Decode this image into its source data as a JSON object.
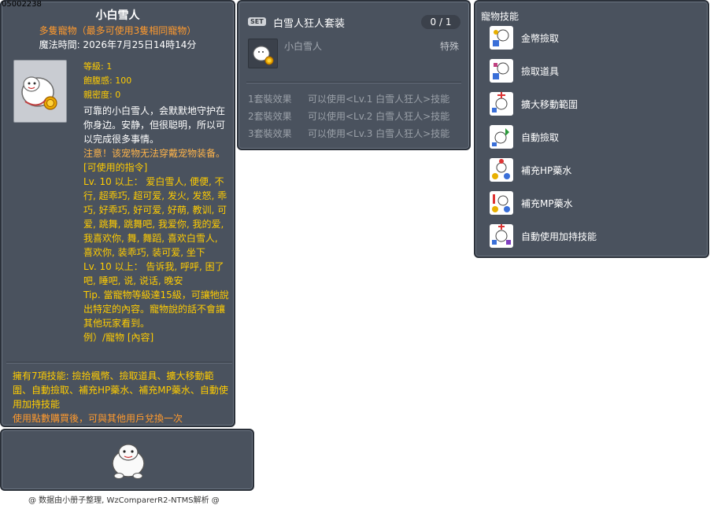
{
  "item": {
    "id": "05002238",
    "title": "小白雪人",
    "subtitle": "多隻寵物（最多可使用3隻相同寵物）",
    "expire": "魔法時間: 2026年7月25日14時14分",
    "stats": {
      "level": "等級: 1",
      "fullness": "飽腹感: 100",
      "closeness": "親密度: 0"
    },
    "desc": {
      "line1": "可靠的小白雪人，会默默地守护在你身边。安静，但很聪明，所以可以完成很多事情。",
      "warning": "注意！该宠物无法穿戴宠物装备。",
      "commands_header": "[可使用的指令]",
      "cmd1": "Lv. 10 以上： 爱白雪人, 便便, 不行, 超乖巧, 超可爱, 发火, 发怒, 乖巧, 好乖巧, 好可爱, 好萌, 教训, 可爱, 跳舞, 跳舞吧, 我爱你, 我的爱, 我喜欢你, 舞, 舞蹈, 喜欢白雪人, 喜欢你, 装乖巧, 装可爱, 坐下",
      "cmd2": "Lv. 10 以上： 告诉我, 呼呼, 困了吧, 睡吧, 说, 说话, 晚安",
      "tip": "Tip. 當寵物等級達15級，可讓牠說出特定的內容。寵物說的話不會讓其他玩家看到。",
      "example": "例）/寵物 [內容]"
    },
    "skills_summary": "擁有7項技能: 撿拾楓幣、撿取道具、擴大移動範圍、自動撿取、補充HP藥水、補充MP藥水、自動使用加持技能",
    "exchange": "使用點數購買後，可與其他用戶兌換一次"
  },
  "credit": "@ 数据由小册子整理, WzComparerR2-NTMS解析 @",
  "set": {
    "badge": "SET",
    "name": "白雪人狂人套装",
    "count": "0 / 1",
    "item_name": "小白雪人",
    "item_type": "特殊",
    "effects": [
      {
        "label": "1套裝效果",
        "text": "可以使用<Lv.1 白雪人狂人>技能"
      },
      {
        "label": "2套裝效果",
        "text": "可以使用<Lv.2 白雪人狂人>技能"
      },
      {
        "label": "3套裝效果",
        "text": "可以使用<Lv.3 白雪人狂人>技能"
      }
    ]
  },
  "pet_skills": {
    "title": "寵物技能",
    "items": [
      {
        "label": "金幣撿取",
        "icon": "coin-pickup-icon"
      },
      {
        "label": "撿取道具",
        "icon": "item-pickup-icon"
      },
      {
        "label": "擴大移動範圍",
        "icon": "expand-range-icon"
      },
      {
        "label": "自動撿取",
        "icon": "auto-pickup-icon"
      },
      {
        "label": "補充HP藥水",
        "icon": "hp-potion-icon"
      },
      {
        "label": "補充MP藥水",
        "icon": "mp-potion-icon"
      },
      {
        "label": "自動使用加持技能",
        "icon": "auto-buff-icon"
      }
    ]
  },
  "colors": {
    "panel_bg": "#4a525e",
    "orange": "#ff9a2e",
    "yellow": "#ffcc00"
  }
}
